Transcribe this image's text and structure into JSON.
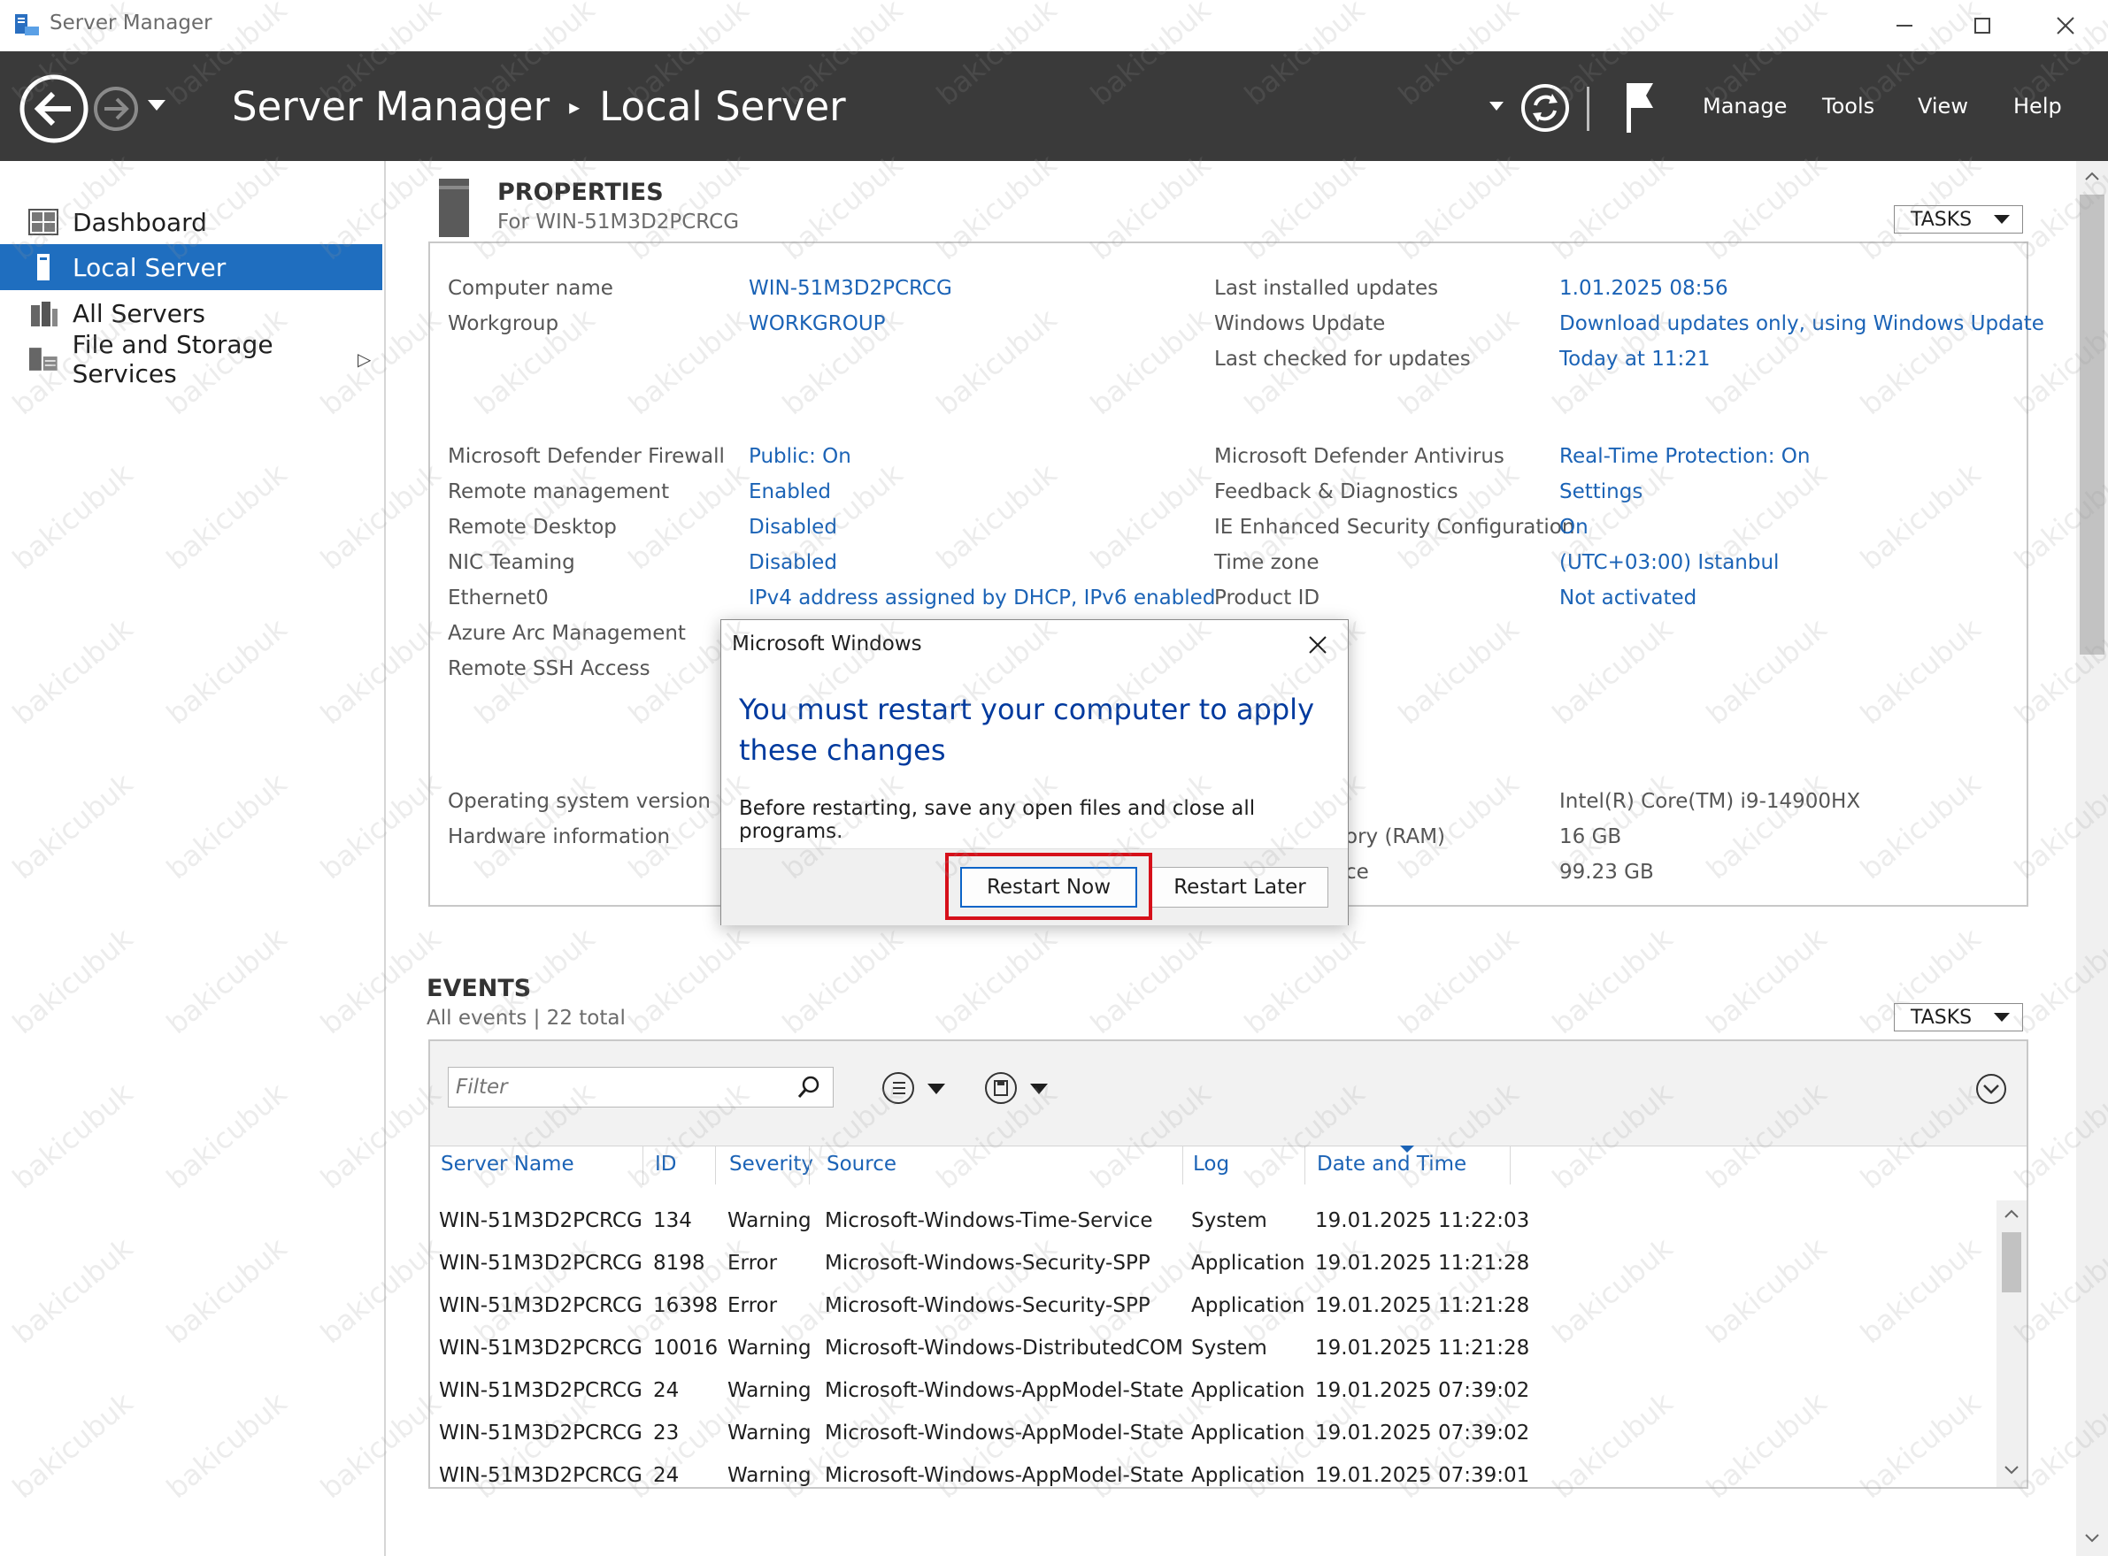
{
  "window": {
    "title": "Server Manager",
    "minimize_icon": "minimize-icon",
    "maximize_icon": "maximize-icon",
    "close_icon": "close-icon"
  },
  "header": {
    "breadcrumb": [
      "Server Manager",
      "Local Server"
    ],
    "menu": [
      "Manage",
      "Tools",
      "View",
      "Help"
    ]
  },
  "sidebar": {
    "items": [
      {
        "label": "Dashboard",
        "icon": "dashboard-icon"
      },
      {
        "label": "Local Server",
        "icon": "local-server-icon",
        "active": true
      },
      {
        "label": "All Servers",
        "icon": "all-servers-icon"
      },
      {
        "label": "File and Storage Services",
        "icon": "file-storage-icon"
      }
    ]
  },
  "properties": {
    "title": "PROPERTIES",
    "subtitle": "For WIN-51M3D2PCRCG",
    "tasks_label": "TASKS",
    "left_rows": [
      {
        "label": "Computer name",
        "value": "WIN-51M3D2PCRCG"
      },
      {
        "label": "Workgroup",
        "value": "WORKGROUP"
      },
      {
        "label": "Microsoft Defender Firewall",
        "value": "Public: On"
      },
      {
        "label": "Remote management",
        "value": "Enabled"
      },
      {
        "label": "Remote Desktop",
        "value": "Disabled"
      },
      {
        "label": "NIC Teaming",
        "value": "Disabled"
      },
      {
        "label": "Ethernet0",
        "value": "IPv4 address assigned by DHCP, IPv6 enabled"
      },
      {
        "label": "Azure Arc Management",
        "value": ""
      },
      {
        "label": "Remote SSH Access",
        "value": ""
      },
      {
        "label": "Operating system version",
        "value": ""
      },
      {
        "label": "Hardware information",
        "value": ""
      }
    ],
    "right_rows": [
      {
        "label": "Last installed updates",
        "value": "1.01.2025 08:56"
      },
      {
        "label": "Windows Update",
        "value": "Download updates only, using Windows Update"
      },
      {
        "label": "Last checked for updates",
        "value": "Today at 11:21"
      },
      {
        "label": "Microsoft Defender Antivirus",
        "value": "Real-Time Protection: On"
      },
      {
        "label": "Feedback & Diagnostics",
        "value": "Settings"
      },
      {
        "label": "IE Enhanced Security Configuration",
        "value": "On"
      },
      {
        "label": "Time zone",
        "value": "(UTC+03:00) Istanbul"
      },
      {
        "label": "Product ID",
        "value": "Not activated"
      },
      {
        "label": "",
        "value": "Intel(R) Core(TM) i9-14900HX"
      },
      {
        "label": "ory (RAM)",
        "value": "16 GB"
      },
      {
        "label": "ce",
        "value": "99.23 GB"
      }
    ]
  },
  "events": {
    "title": "EVENTS",
    "subtitle": "All events | 22 total",
    "tasks_label": "TASKS",
    "filter_placeholder": "Filter",
    "columns": [
      "Server Name",
      "ID",
      "Severity",
      "Source",
      "Log",
      "Date and Time"
    ],
    "rows": [
      [
        "WIN-51M3D2PCRCG",
        "134",
        "Warning",
        "Microsoft-Windows-Time-Service",
        "System",
        "19.01.2025 11:22:03"
      ],
      [
        "WIN-51M3D2PCRCG",
        "8198",
        "Error",
        "Microsoft-Windows-Security-SPP",
        "Application",
        "19.01.2025 11:21:28"
      ],
      [
        "WIN-51M3D2PCRCG",
        "16398",
        "Error",
        "Microsoft-Windows-Security-SPP",
        "Application",
        "19.01.2025 11:21:28"
      ],
      [
        "WIN-51M3D2PCRCG",
        "10016",
        "Warning",
        "Microsoft-Windows-DistributedCOM",
        "System",
        "19.01.2025 11:21:28"
      ],
      [
        "WIN-51M3D2PCRCG",
        "24",
        "Warning",
        "Microsoft-Windows-AppModel-State",
        "Application",
        "19.01.2025 07:39:02"
      ],
      [
        "WIN-51M3D2PCRCG",
        "23",
        "Warning",
        "Microsoft-Windows-AppModel-State",
        "Application",
        "19.01.2025 07:39:02"
      ],
      [
        "WIN-51M3D2PCRCG",
        "24",
        "Warning",
        "Microsoft-Windows-AppModel-State",
        "Application",
        "19.01.2025 07:39:01"
      ]
    ]
  },
  "dialog": {
    "title": "Microsoft Windows",
    "heading": "You must restart your computer to apply these changes",
    "message": "Before restarting, save any open files and close all programs.",
    "restart_now": "Restart Now",
    "restart_later": "Restart Later"
  },
  "watermark": "bakicubuk",
  "colors": {
    "header_bg": "#3a3a3a",
    "accent": "#1f6ebf",
    "link": "#1b63b6",
    "dialog_heading": "#003a9e",
    "highlight": "#d6101a"
  }
}
